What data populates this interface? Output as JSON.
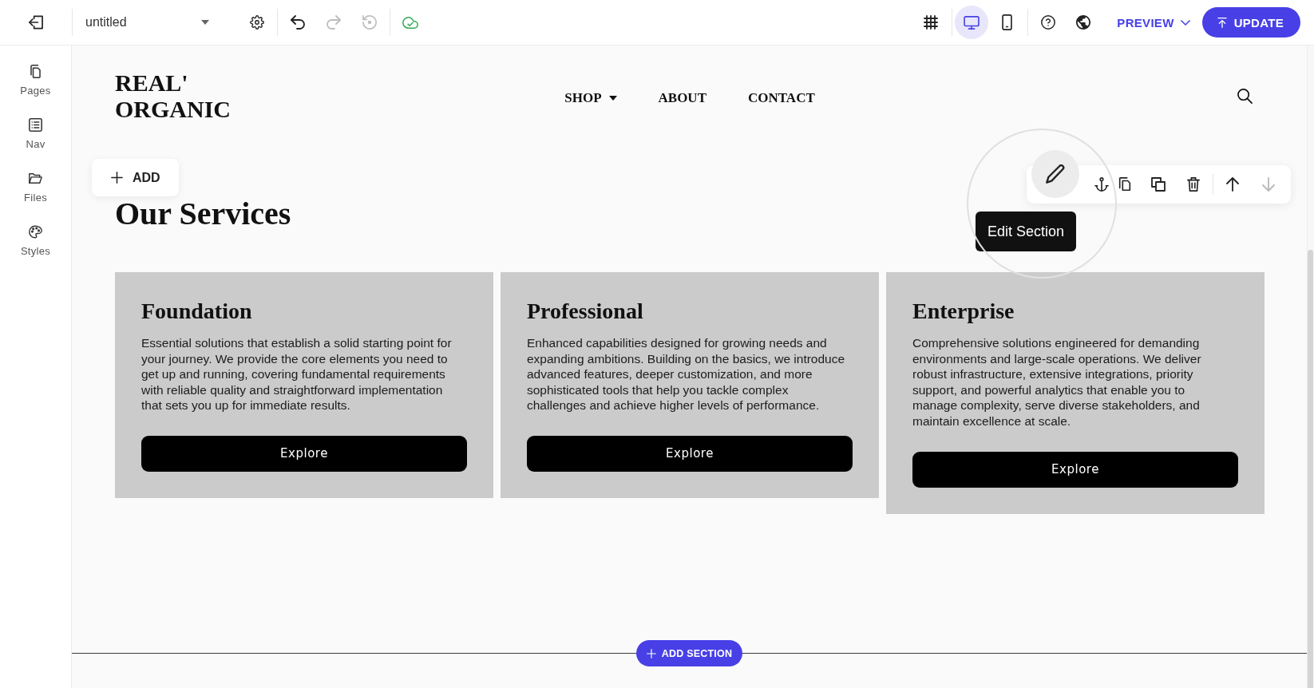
{
  "top_bar": {
    "document_title": "untitled",
    "history_buttons": [
      {
        "kind": "undo",
        "disabled": false
      },
      {
        "kind": "redo",
        "disabled": true
      },
      {
        "kind": "restore",
        "disabled": true
      }
    ],
    "view_modes": [
      {
        "kind": "desktop",
        "selected": true
      },
      {
        "kind": "mobile",
        "selected": false
      }
    ],
    "preview_button": {
      "label": "PREVIEW"
    },
    "update_button": {
      "label": "UPDATE"
    }
  },
  "sidebar": {
    "items": [
      {
        "kind": "pages",
        "label": "Pages"
      },
      {
        "kind": "nav",
        "label": "Nav"
      },
      {
        "kind": "files",
        "label": "Files"
      },
      {
        "kind": "styles",
        "label": "Styles"
      }
    ]
  },
  "canvas": {
    "site_header": {
      "logo": "REAL' ORGANIC",
      "nav": [
        {
          "label": "SHOP",
          "has_dropdown": true
        },
        {
          "label": "ABOUT",
          "has_dropdown": false
        },
        {
          "label": "CONTACT",
          "has_dropdown": false
        }
      ]
    },
    "add_button": {
      "label": "ADD"
    },
    "section": {
      "heading": "Our Services",
      "cards": [
        {
          "title": "Foundation",
          "body": "Essential solutions that establish a solid starting point for your journey. We provide the core elements you need to get up and running, covering fundamental requirements with reliable quality and straightforward implementation that sets you up for immediate results.",
          "button": "Explore"
        },
        {
          "title": "Professional",
          "body": "Enhanced capabilities designed for growing needs and expanding ambitions. Building on the basics, we introduce advanced features, deeper customization, and more sophisticated tools that help you tackle complex challenges and achieve higher levels of performance.",
          "button": "Explore"
        },
        {
          "title": "Enterprise",
          "body": "Comprehensive solutions engineered for demanding environments and large-scale operations. We deliver robust infrastructure, extensive integrations, priority support, and powerful analytics that enable you to manage complexity, serve diverse stakeholders, and maintain excellence at scale.",
          "button": "Explore"
        }
      ]
    },
    "section_toolbar": {
      "tooltip": "Edit Section",
      "action_groups": [
        {
          "actions": [
            {
              "kind": "edit",
              "hovered": true,
              "disabled": false
            },
            {
              "kind": "anchor",
              "hovered": false,
              "disabled": false
            },
            {
              "kind": "copy",
              "hovered": false,
              "disabled": false
            },
            {
              "kind": "duplicate",
              "hovered": false,
              "disabled": false
            },
            {
              "kind": "delete",
              "hovered": false,
              "disabled": false
            }
          ]
        },
        {
          "actions": [
            {
              "kind": "move_up",
              "hovered": false,
              "disabled": false
            },
            {
              "kind": "move_down",
              "hovered": false,
              "disabled": true
            }
          ]
        }
      ]
    },
    "add_section_button": {
      "label": "ADD SECTION"
    }
  }
}
